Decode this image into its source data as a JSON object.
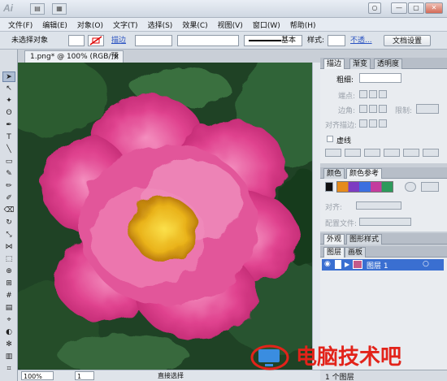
{
  "titlebar": {
    "logo": "Ai",
    "icons": [
      "bridge-icon",
      "arrange-documents-icon"
    ],
    "buttons": {
      "minimize": "—",
      "restore": "▢",
      "close": "✕",
      "group_a": "▭",
      "group_b": "○"
    }
  },
  "menu": [
    "文件(F)",
    "编辑(E)",
    "对象(O)",
    "文字(T)",
    "选择(S)",
    "效果(C)",
    "视图(V)",
    "窗口(W)",
    "帮助(H)"
  ],
  "control": {
    "selection": "未选择对象",
    "stroke_link": "描边",
    "style_basic": "基本",
    "style_label": "样式:",
    "opacity_link": "不透...",
    "doc_settings": "文档设置"
  },
  "document": {
    "tab_title": "1.png* @ 100% (RGB/预览)",
    "close": "×"
  },
  "status": {
    "zoom": "100%",
    "page": "1",
    "tool": "直接选择"
  },
  "panels": {
    "stroke_tabs": [
      "描边",
      "渐变",
      "透明度"
    ],
    "weight_label": "粗细:",
    "cap_label": "端点:",
    "corner_label": "边角:",
    "limit_label": "限制:",
    "align_label": "对齐描边:",
    "dashed_label": "虚线",
    "color_tabs": [
      "颜色",
      "颜色参考"
    ],
    "align_label2": "对齐:",
    "config_label": "配置文件:",
    "appearance_tabs": [
      "外观",
      "图形样式"
    ],
    "layers_tabs": [
      "图层",
      "画板"
    ],
    "layer_name": "图层 1",
    "layer_count": "1 个图层"
  },
  "watermark": {
    "text": "电脑技术吧"
  },
  "colors": {
    "accent": "#3a6fd1",
    "flower": "#e0438f",
    "center": "#e9b21a",
    "background": "#1f4225",
    "watermark": "#e2231a"
  }
}
